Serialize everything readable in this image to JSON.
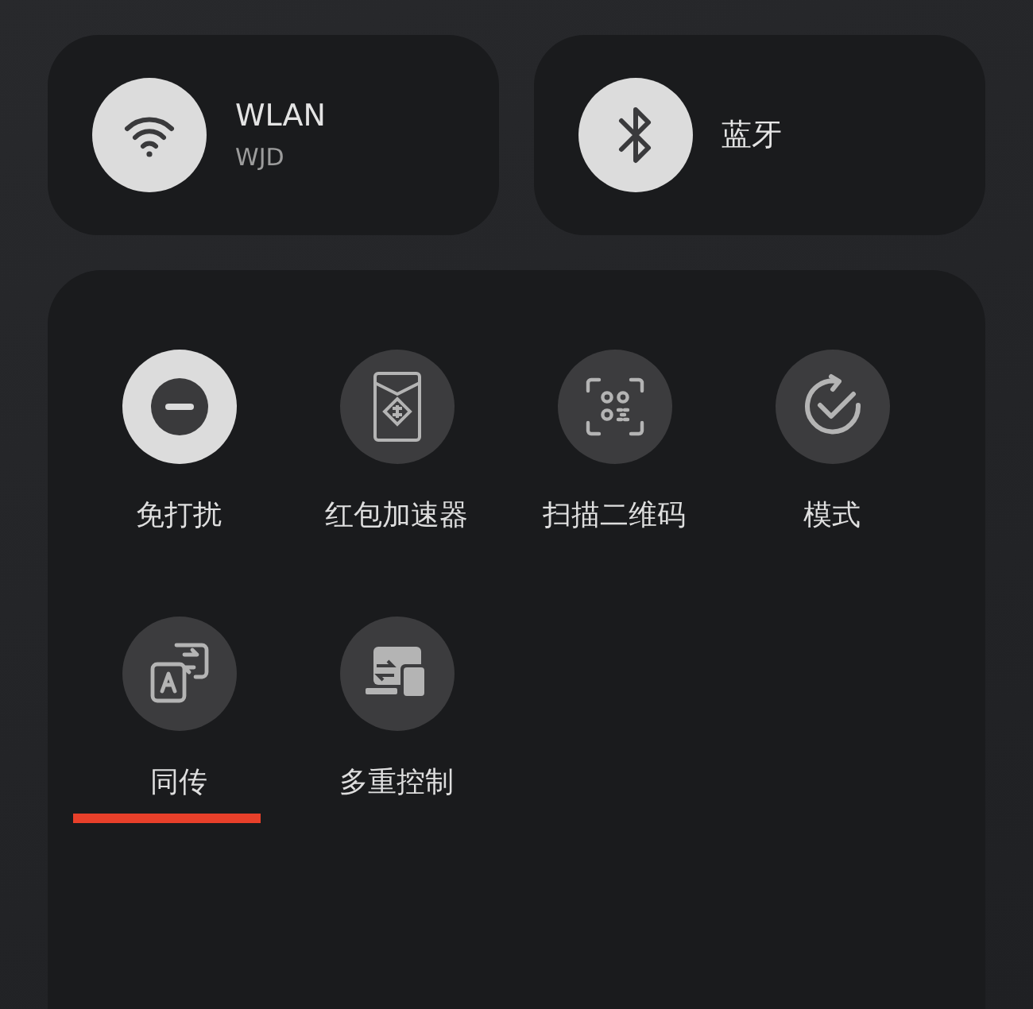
{
  "connections": [
    {
      "kind": "wifi",
      "title": "WLAN",
      "subtitle": "WJD",
      "on": true
    },
    {
      "kind": "bluetooth",
      "title": "蓝牙",
      "on": true
    }
  ],
  "tiles": [
    {
      "kind": "dnd",
      "label": "免打扰",
      "on": true,
      "underlined": false
    },
    {
      "kind": "envelope",
      "label": "红包加速器",
      "on": false,
      "underlined": false
    },
    {
      "kind": "qr",
      "label": "扫描二维码",
      "on": false,
      "underlined": false
    },
    {
      "kind": "mode",
      "label": "模式",
      "on": false,
      "underlined": false
    },
    {
      "kind": "translate",
      "label": "同传",
      "on": false,
      "underlined": true
    },
    {
      "kind": "multi",
      "label": "多重控制",
      "on": false,
      "underlined": false
    }
  ]
}
